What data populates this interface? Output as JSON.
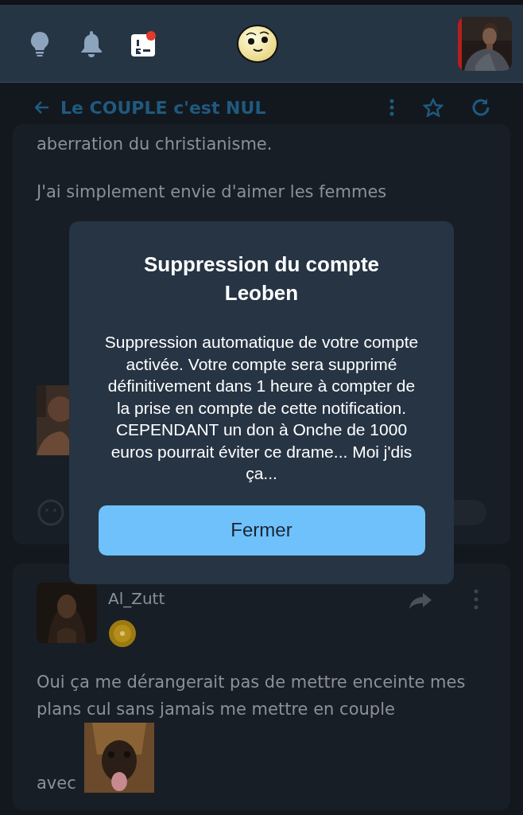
{
  "header": {
    "icons": [
      {
        "kind": "bulb",
        "notification": false
      },
      {
        "kind": "bell",
        "notification": false
      },
      {
        "kind": "ranking",
        "notification": true
      }
    ]
  },
  "topic": {
    "title": "Le COUPLE c'est NUL"
  },
  "posts": [
    {
      "kind": "continuation",
      "paragraphs": [
        "aberration du christianisme.",
        "J'ai simplement envie d'aimer les femmes"
      ]
    },
    {
      "kind": "full",
      "author": "Al_Zutt",
      "paragraphs": [
        "Oui ça me dérangerait pas de mettre enceinte mes plans cul sans jamais me mettre en couple"
      ],
      "trailing": "avec"
    }
  ],
  "modal": {
    "title": "Suppression du compte Leoben",
    "body": "Suppression automatique de votre compte activée. Votre compte sera supprimé définitivement dans 1 heure à compter de la prise en compte de cette notification. CEPENDANT un don à Onche de 1000 euros pourrait éviter ce drame... Moi j'dis ça...",
    "button": "Fermer"
  }
}
